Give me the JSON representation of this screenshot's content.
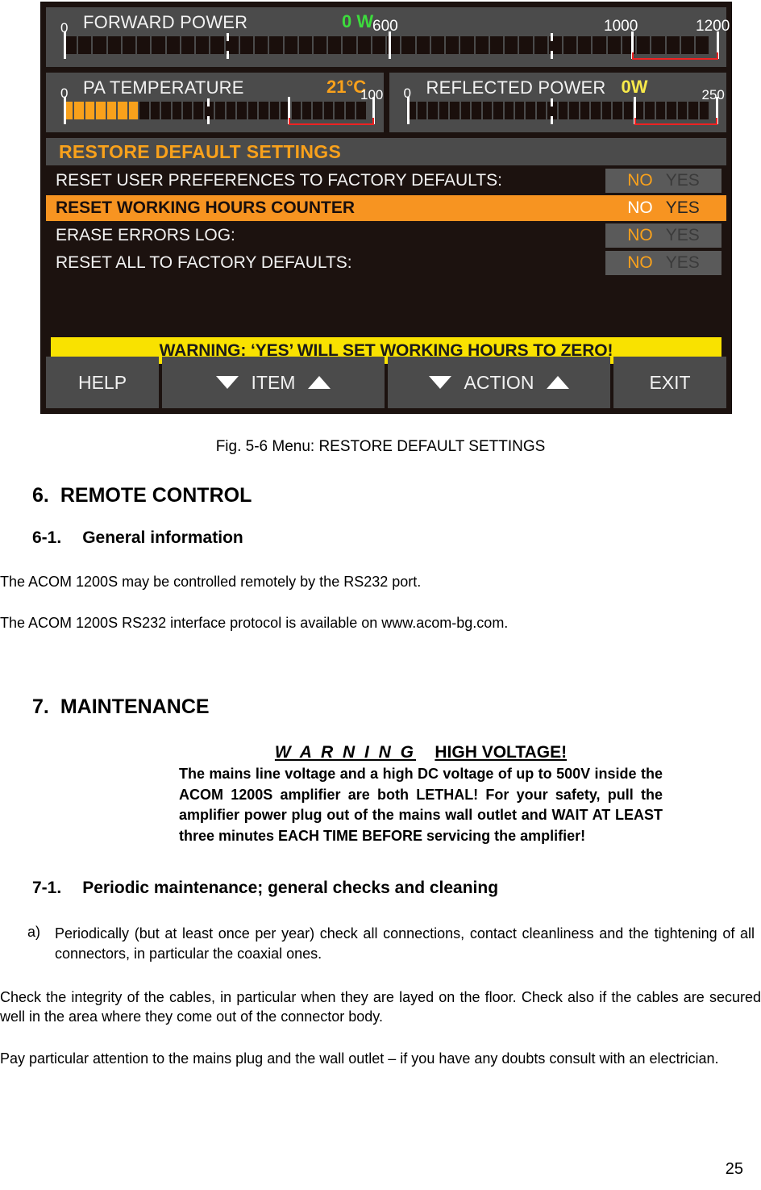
{
  "lcd": {
    "meters": [
      {
        "name": "forward-power",
        "title": "FORWARD POWER",
        "value": "0 W",
        "value_color": "#3ddb3d",
        "min_label": "0",
        "labels": [
          "600",
          "1000",
          "1200"
        ],
        "segments": 44,
        "filled": 0,
        "redzone_from": "1000",
        "redzone_to": "1200"
      },
      {
        "name": "pa-temperature",
        "title": "PA TEMPERATURE",
        "value": "21°C",
        "value_color": "#f9a11b",
        "min_label": "0",
        "labels": [
          "100"
        ],
        "segments": 28,
        "filled": 7,
        "redzone_from": "80",
        "redzone_to": "100"
      },
      {
        "name": "reflected-power",
        "title": "REFLECTED POWER",
        "value": "0W",
        "value_color": "#f7e94a",
        "min_label": "0",
        "labels": [
          "250"
        ],
        "segments": 28,
        "filled": 0,
        "redzone_from": "200",
        "redzone_to": "250"
      }
    ],
    "menu_title": "RESTORE DEFAULT SETTINGS",
    "menu_rows": [
      {
        "label": "RESET USER PREFERENCES TO FACTORY DEFAULTS:",
        "no": "NO",
        "yes": "YES",
        "selected": false
      },
      {
        "label": "RESET WORKING HOURS COUNTER",
        "no": "NO",
        "yes": "YES",
        "selected": true
      },
      {
        "label": "ERASE ERRORS LOG:",
        "no": "NO",
        "yes": "YES",
        "selected": false
      },
      {
        "label": "RESET ALL TO FACTORY DEFAULTS:",
        "no": "NO",
        "yes": "YES",
        "selected": false
      }
    ],
    "warning_bar": "WARNING: ‘YES’ WILL SET WORKING HOURS TO ZERO!",
    "softkeys": {
      "help": "HELP",
      "item": "ITEM",
      "action": "ACTION",
      "exit": "EXIT"
    },
    "colors": {
      "accent_orange": "#f9a11b",
      "highlight_orange": "#f79421",
      "warning_yellow": "#f9e200",
      "redzone": "#ee2222",
      "panel_bg": "#1c120f",
      "meter_bg": "#4b4b4b"
    }
  },
  "document": {
    "figure_caption": "Fig. 5-6 Menu: RESTORE DEFAULT SETTINGS",
    "section6": {
      "number": "6.",
      "title": "REMOTE CONTROL",
      "sub_number": "6-1.",
      "sub_title": "General information",
      "para1": "The ACOM 1200S may be controlled remotely by the RS232 port.",
      "para2": "The ACOM 1200S RS232 interface protocol is available on www.acom-bg.com."
    },
    "section7": {
      "number": "7.",
      "title": "MAINTENANCE",
      "warning_word": "W A R N I N G",
      "warning_high_voltage": "HIGH VOLTAGE!",
      "warning_body": "The mains line voltage and a high DC voltage of up to 500V inside the ACOM 1200S amplifier are both LETHAL! For your safety, pull the amplifier power plug out of the mains wall outlet and WAIT AT LEAST three minutes EACH TIME BEFORE servicing the amplifier!",
      "sub_number": "7-1.",
      "sub_title": "Periodic maintenance; general checks and cleaning",
      "item_a_marker": "a)",
      "item_a_text": "Periodically (but at least once per year) check all connections, contact cleanliness and the tightening of all connectors, in particular the coaxial ones.",
      "para1": "Check the integrity of the cables, in particular when they are layed on the floor. Check also if the cables are secured well in the area where they come out of the connector body.",
      "para2": "Pay particular attention to the mains plug and the wall outlet – if you have any doubts consult with an electrician."
    },
    "page_number": "25"
  }
}
